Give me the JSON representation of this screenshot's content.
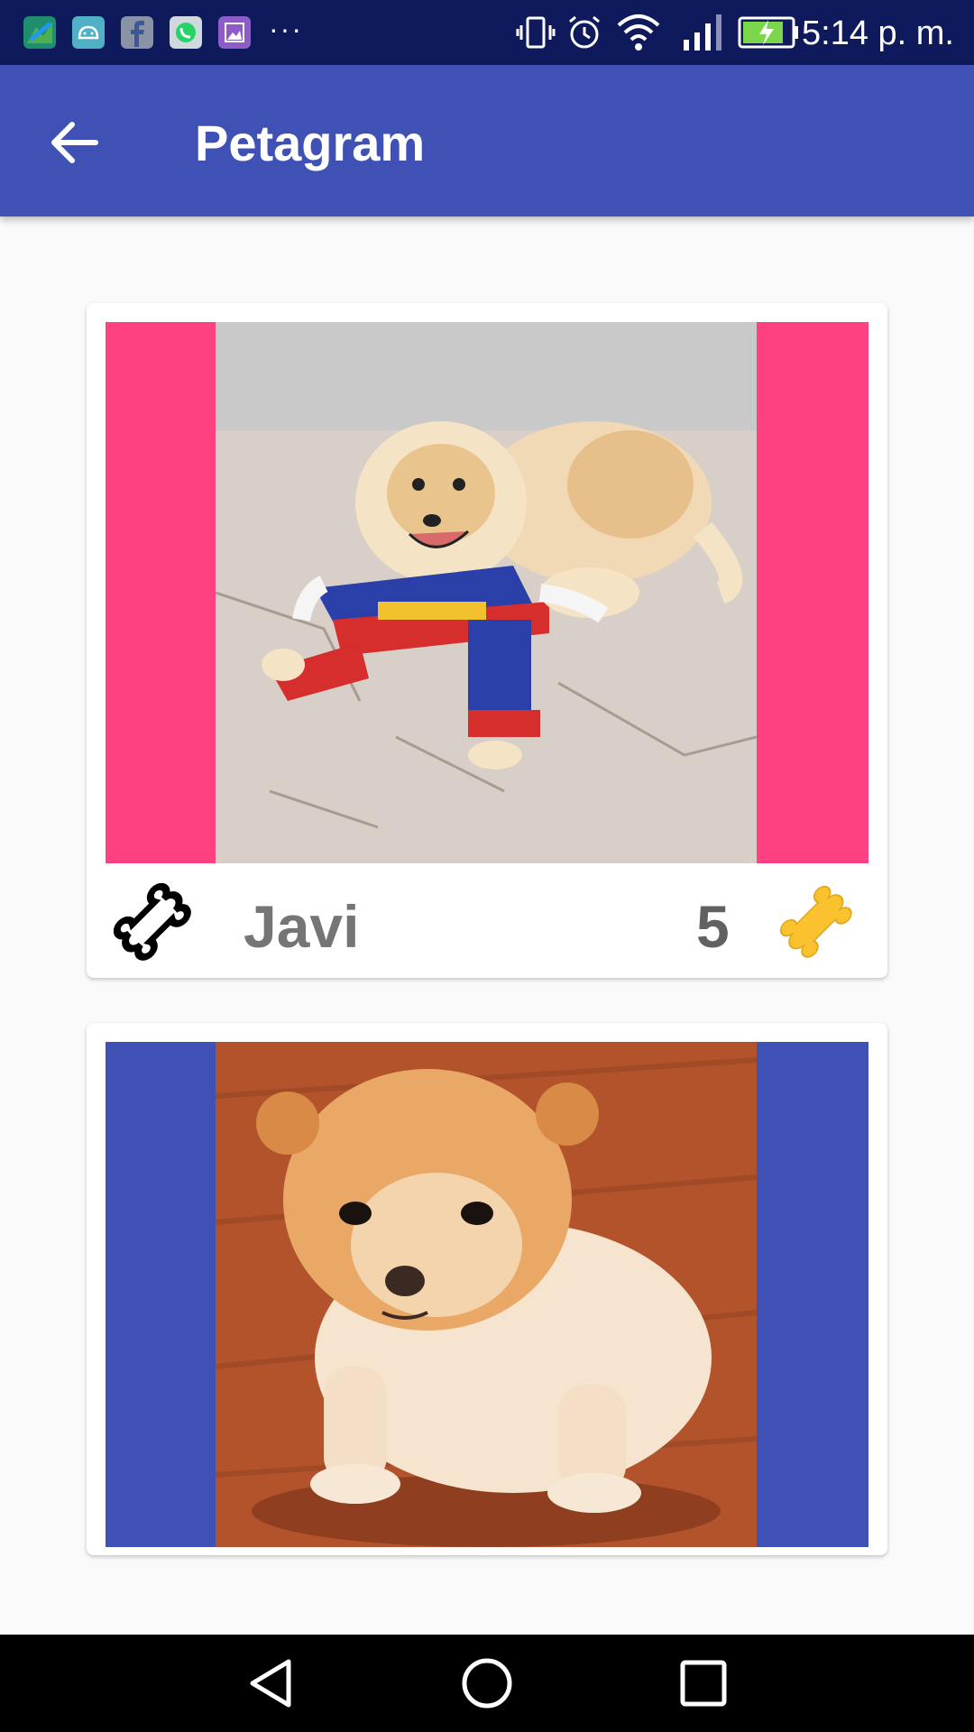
{
  "status_bar": {
    "time": "5:14 p. m.",
    "more": "···",
    "notification_icons": [
      "maps-icon",
      "android-icon",
      "facebook-icon",
      "whatsapp-icon",
      "gallery-icon"
    ],
    "system_icons": [
      "vibrate-icon",
      "alarm-icon",
      "wifi-icon",
      "signal-icon",
      "battery-charging-icon"
    ]
  },
  "app_bar": {
    "title": "Petagram",
    "back_icon": "arrow-back-icon",
    "color": "#3f51b5"
  },
  "pets": [
    {
      "name": "Javi",
      "likes": "5",
      "background": "#ff4081",
      "photo": "pomeranian-in-superhero-costume"
    },
    {
      "name": "",
      "likes": "",
      "background": "#3f51b5",
      "photo": "pomeranian-boo"
    }
  ],
  "colors": {
    "accent": "#ff4081",
    "primary": "#3f51b5",
    "bone_rated": "#f9c22e",
    "bone_outline": "#000000"
  },
  "nav_bar": {
    "buttons": [
      "back-triangle-icon",
      "home-circle-icon",
      "recents-square-icon"
    ]
  }
}
